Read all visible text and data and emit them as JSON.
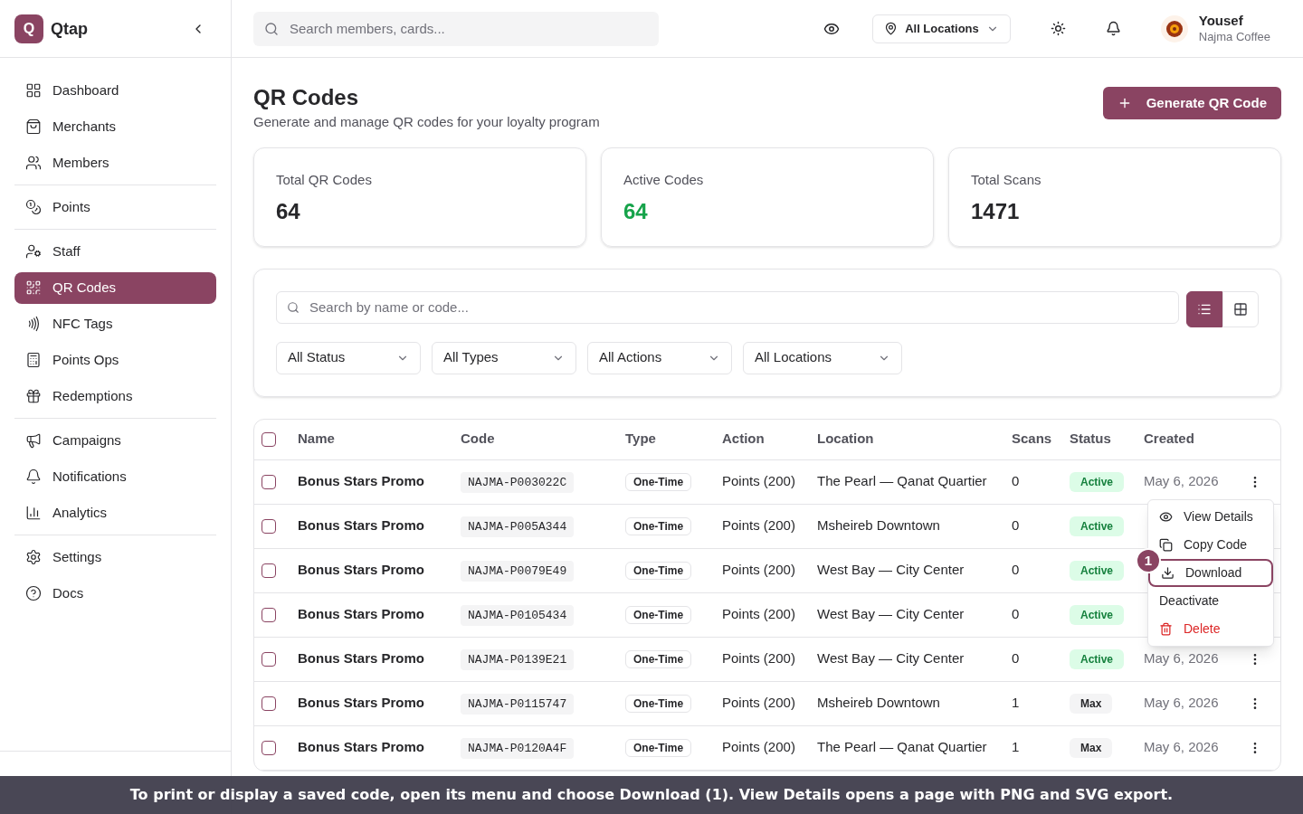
{
  "brand": {
    "logo_letter": "Q",
    "name": "Qtap"
  },
  "sidebar": {
    "groups": [
      {
        "items": [
          {
            "label": "Dashboard",
            "selected": false
          },
          {
            "label": "Merchants",
            "selected": false
          },
          {
            "label": "Members",
            "selected": false
          }
        ]
      },
      {
        "items": [
          {
            "label": "Points",
            "selected": false
          }
        ]
      },
      {
        "items": [
          {
            "label": "Staff",
            "selected": false
          },
          {
            "label": "QR Codes",
            "selected": true
          },
          {
            "label": "NFC Tags",
            "selected": false
          },
          {
            "label": "Points Ops",
            "selected": false
          },
          {
            "label": "Redemptions",
            "selected": false
          }
        ]
      },
      {
        "items": [
          {
            "label": "Campaigns",
            "selected": false
          },
          {
            "label": "Notifications",
            "selected": false
          },
          {
            "label": "Analytics",
            "selected": false
          }
        ]
      },
      {
        "items": [
          {
            "label": "Settings",
            "selected": false
          },
          {
            "label": "Docs",
            "selected": false
          }
        ]
      }
    ]
  },
  "header": {
    "search": {
      "placeholder": "Search members, cards..."
    },
    "location": "All Locations",
    "user": {
      "name": "Yousef",
      "org": "Najma Coffee"
    }
  },
  "page": {
    "title": "QR Codes",
    "subtitle": "Generate and manage QR codes for your loyalty program",
    "primary_button": "Generate QR Code"
  },
  "stats": [
    {
      "label": "Total QR Codes",
      "value": "64",
      "kind": "plain"
    },
    {
      "label": "Active Codes",
      "value": "64",
      "kind": "positive"
    },
    {
      "label": "Total Scans",
      "value": "1471",
      "kind": "plain"
    }
  ],
  "filters": {
    "search": {
      "placeholder": "Search by name or code..."
    },
    "views": [
      {
        "kind": "list",
        "selected": true
      },
      {
        "kind": "grid",
        "selected": false
      }
    ],
    "selects": [
      "All Status",
      "All Types",
      "All Actions",
      "All Locations"
    ]
  },
  "table": {
    "columns": [
      "Name",
      "Code",
      "Type",
      "Action",
      "Location",
      "Scans",
      "Status",
      "Created"
    ],
    "select_all_checked": false,
    "rows": [
      {
        "checked": false,
        "name": "Bonus Stars Promo",
        "code": "NAJMA-P003022C",
        "type": "One-Time",
        "action": "Points (200)",
        "location": "The Pearl — Qanat Quartier",
        "scans": "0",
        "status": {
          "label": "Active",
          "kind": "active"
        },
        "created": "May 6, 2026"
      },
      {
        "checked": false,
        "name": "Bonus Stars Promo",
        "code": "NAJMA-P005A344",
        "type": "One-Time",
        "action": "Points (200)",
        "location": "Msheireb Downtown",
        "scans": "0",
        "status": {
          "label": "Active",
          "kind": "active"
        }
      },
      {
        "checked": false,
        "name": "Bonus Stars Promo",
        "code": "NAJMA-P0079E49",
        "type": "One-Time",
        "action": "Points (200)",
        "location": "West Bay — City Center",
        "scans": "0",
        "status": {
          "label": "Active",
          "kind": "active"
        }
      },
      {
        "checked": false,
        "name": "Bonus Stars Promo",
        "code": "NAJMA-P0105434",
        "type": "One-Time",
        "action": "Points (200)",
        "location": "West Bay — City Center",
        "scans": "0",
        "status": {
          "label": "Active",
          "kind": "active"
        }
      },
      {
        "checked": false,
        "name": "Bonus Stars Promo",
        "code": "NAJMA-P0139E21",
        "type": "One-Time",
        "action": "Points (200)",
        "location": "West Bay — City Center",
        "scans": "0",
        "status": {
          "label": "Active",
          "kind": "active"
        },
        "created": "May 6, 2026"
      },
      {
        "checked": false,
        "name": "Bonus Stars Promo",
        "code": "NAJMA-P0115747",
        "type": "One-Time",
        "action": "Points (200)",
        "location": "Msheireb Downtown",
        "scans": "1",
        "status": {
          "label": "Max",
          "kind": "max"
        },
        "created": "May 6, 2026"
      },
      {
        "checked": false,
        "name": "Bonus Stars Promo",
        "code": "NAJMA-P0120A4F",
        "type": "One-Time",
        "action": "Points (200)",
        "location": "The Pearl — Qanat Quartier",
        "scans": "1",
        "status": {
          "label": "Max",
          "kind": "max"
        },
        "created": "May 6, 2026"
      }
    ]
  },
  "row_menu": {
    "items": [
      {
        "label": "View Details",
        "kind": "view",
        "highlighted": false
      },
      {
        "label": "Copy Code",
        "kind": "copy",
        "highlighted": false
      },
      {
        "label": "Download",
        "kind": "download",
        "highlighted": true,
        "callout": "1"
      },
      {
        "label": "Deactivate",
        "kind": "plain",
        "highlighted": false
      },
      {
        "label": "Delete",
        "kind": "danger",
        "highlighted": false
      }
    ]
  },
  "banner": "To print or display a saved code, open its menu and choose Download (1). View Details opens a page with PNG and SVG export."
}
